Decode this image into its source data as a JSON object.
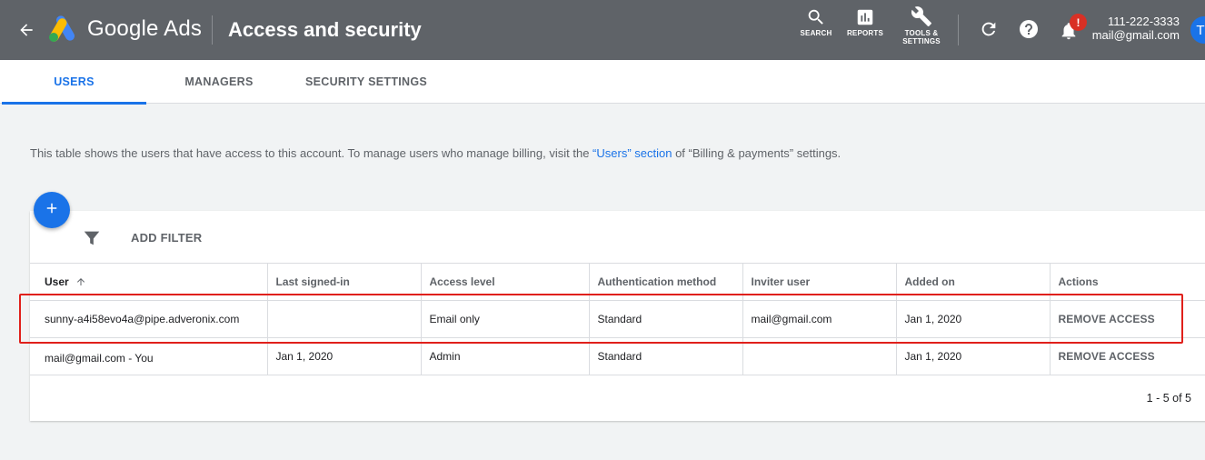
{
  "header": {
    "brand": "Google Ads",
    "title": "Access and security",
    "search_label": "SEARCH",
    "reports_label": "REPORTS",
    "tools_label_1": "TOOLS &",
    "tools_label_2": "SETTINGS",
    "notification_badge": "!",
    "account_id": "111-222-3333",
    "account_email": "mail@gmail.com",
    "avatar_initial": "T"
  },
  "tabs": [
    {
      "label": "USERS",
      "active": true
    },
    {
      "label": "MANAGERS",
      "active": false
    },
    {
      "label": "SECURITY SETTINGS",
      "active": false
    }
  ],
  "description": {
    "before": "This table shows the users that have access to this account. To manage users who manage billing, visit the ",
    "link": "“Users” section",
    "after": " of “Billing & payments” settings."
  },
  "toolbar": {
    "add_filter": "ADD FILTER"
  },
  "table": {
    "columns": [
      "User",
      "Last signed-in",
      "Access level",
      "Authentication method",
      "Inviter user",
      "Added on",
      "Actions"
    ],
    "rows": [
      [
        "sunny-a4i58evo4a@pipe.adveronix.com",
        "",
        "Email only",
        "Standard",
        "mail@gmail.com",
        "Jan 1, 2020",
        "REMOVE ACCESS"
      ],
      [
        "mail@gmail.com - You",
        "Jan 1, 2020",
        "Admin",
        "Standard",
        "",
        "Jan 1, 2020",
        "REMOVE ACCESS"
      ]
    ]
  },
  "pagination": "1 - 5 of 5",
  "colors": {
    "header_bg": "#5f6368",
    "accent": "#1a73e8",
    "highlight": "#e0201b"
  }
}
